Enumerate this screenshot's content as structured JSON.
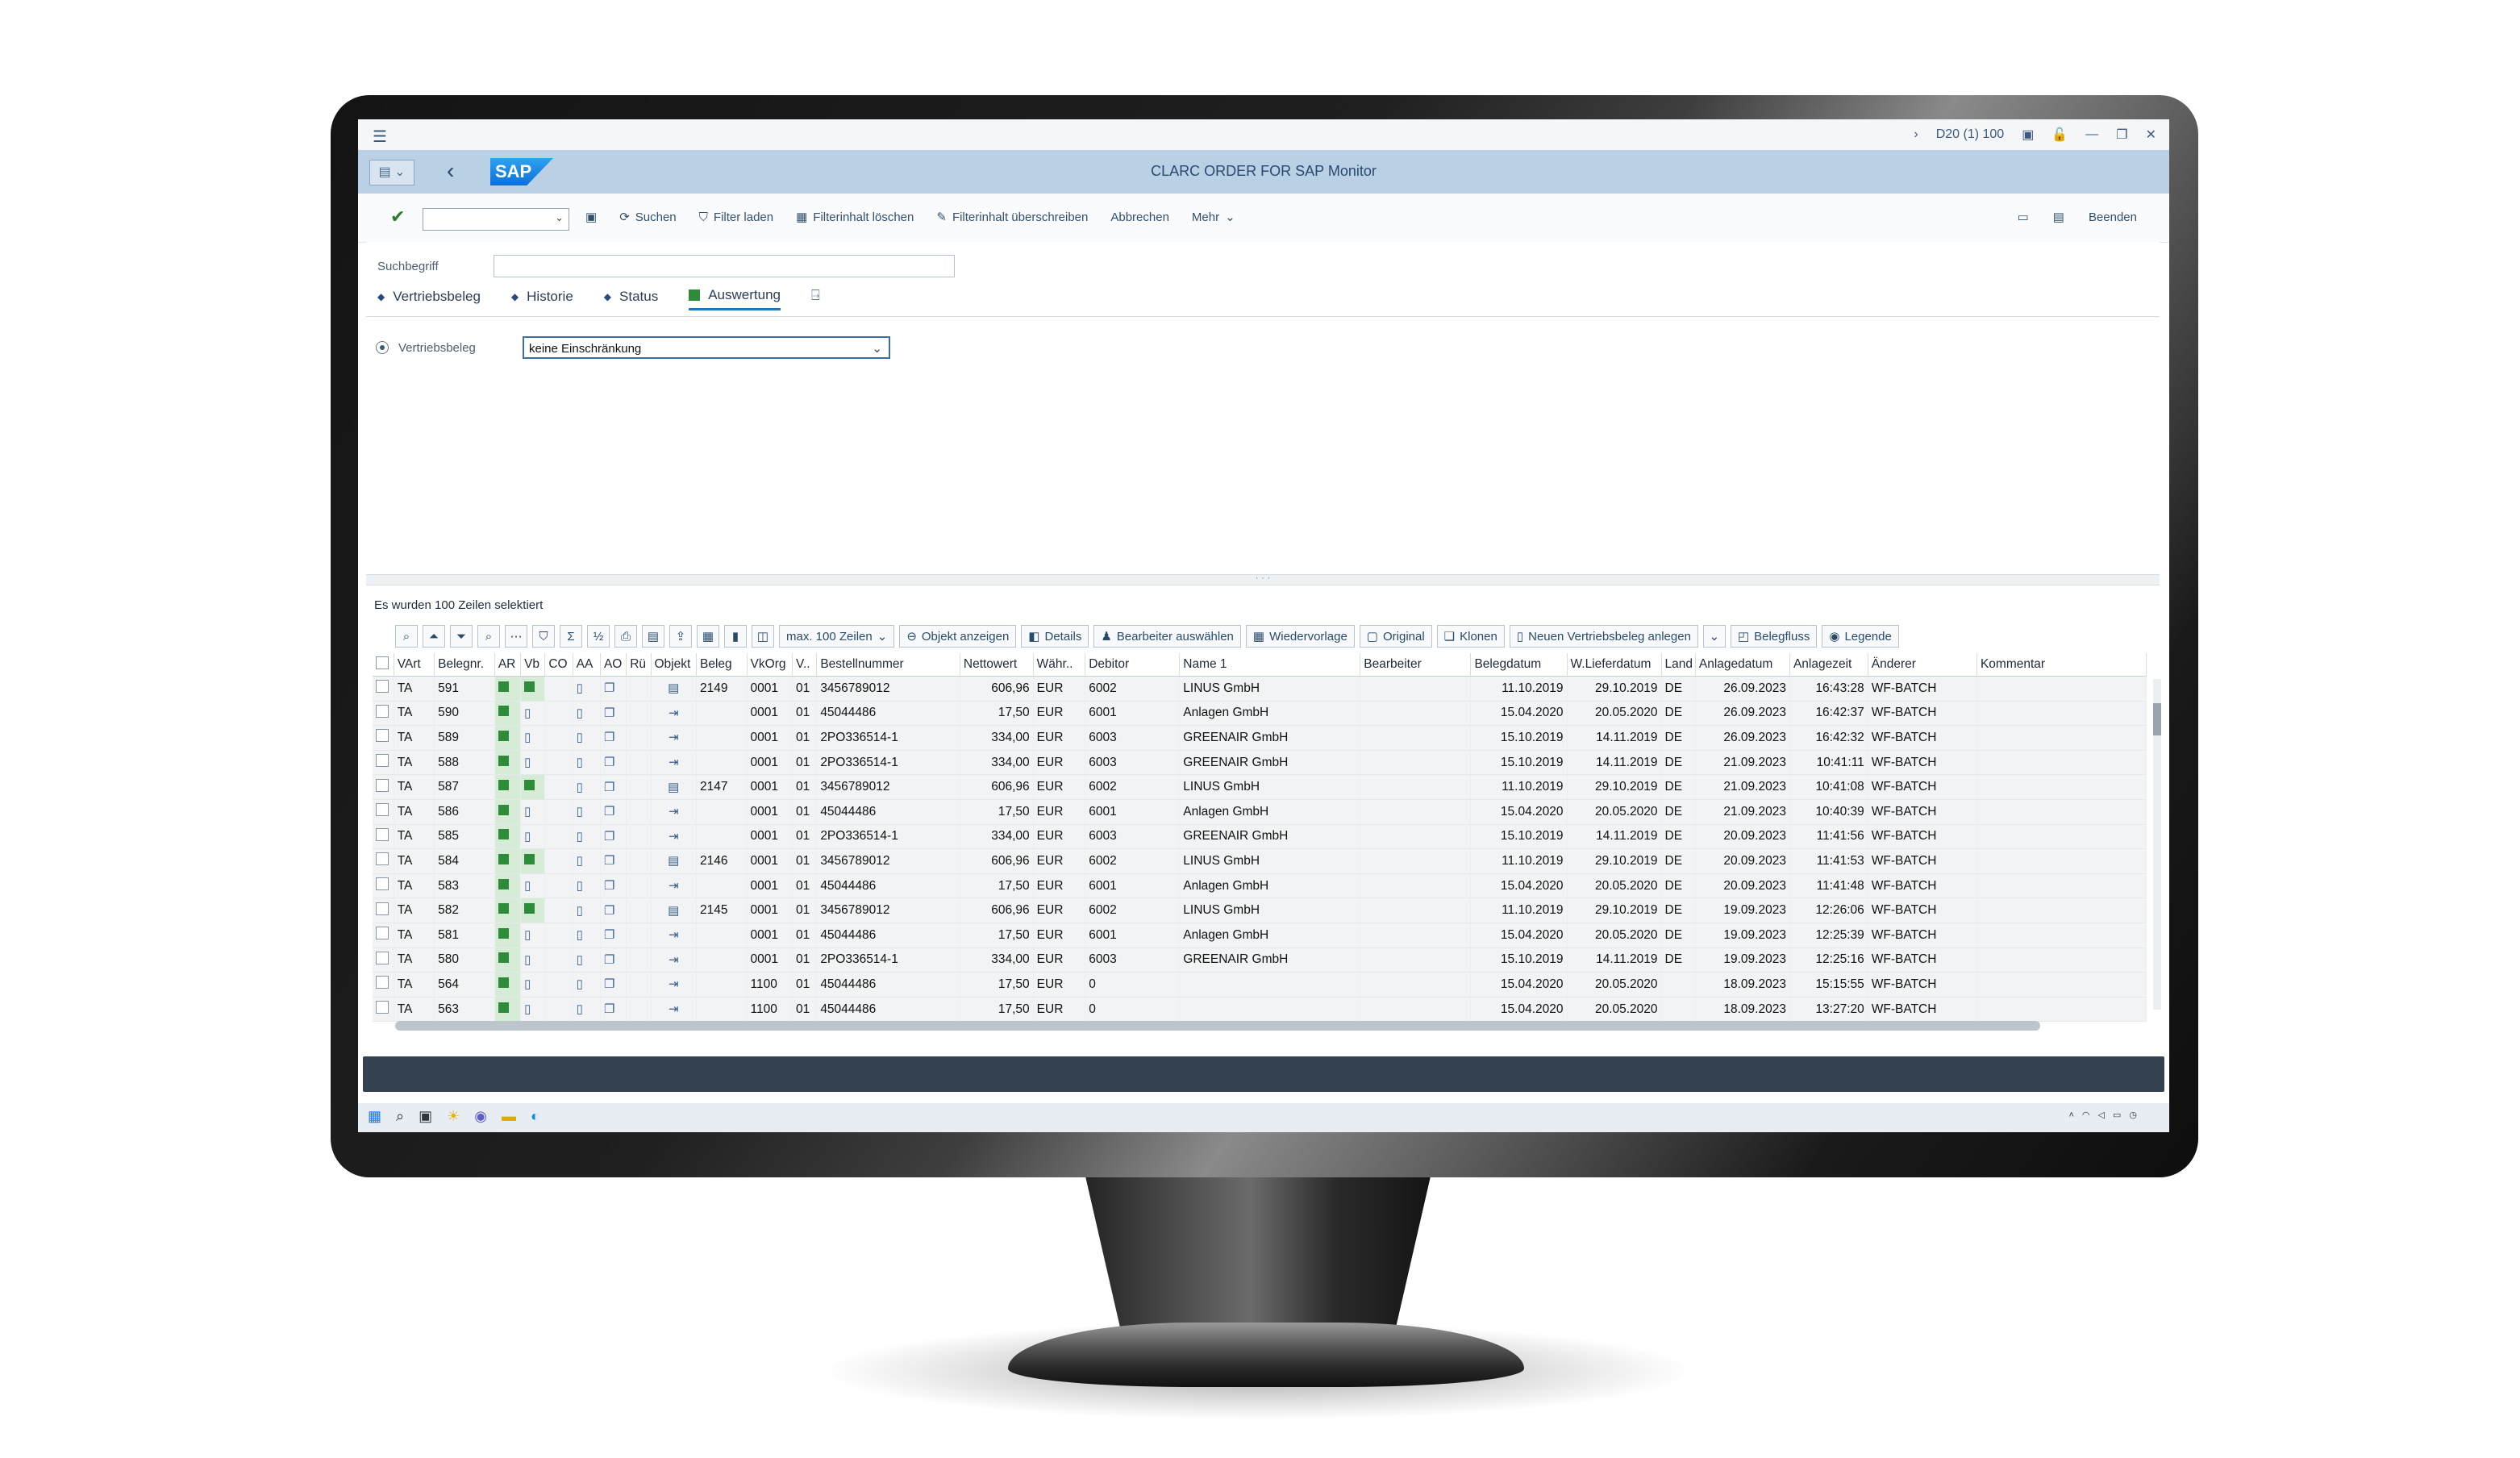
{
  "system": {
    "session": "D20 (1) 100",
    "icons": [
      "chevron-right-icon",
      "session-icon",
      "lock-icon",
      "minimize-icon",
      "maximize-icon",
      "close-icon"
    ]
  },
  "title": {
    "app": "CLARC ORDER FOR SAP Monitor",
    "logo": "SAP"
  },
  "toolbar": {
    "items": [
      "Suchen",
      "Filter laden",
      "Filterinhalt löschen",
      "Filterinhalt überschreiben",
      "Abbrechen",
      "Mehr"
    ],
    "exit": "Beenden"
  },
  "selection": {
    "search_label": "Suchbegriff",
    "search_value": "",
    "tabs": [
      "Vertriebsbeleg",
      "Historie",
      "Status",
      "Auswertung"
    ],
    "active_tab": "Auswertung",
    "field_label": "Vertriebsbeleg",
    "field_value": "keine Einschränkung"
  },
  "result": {
    "info": "Es wurden 100 Zeilen selektiert",
    "toolbar": {
      "max_rows": "max. 100 Zeilen",
      "buttons": [
        "Objekt anzeigen",
        "Details",
        "Bearbeiter auswählen",
        "Wiedervorlage",
        "Original",
        "Klonen",
        "Neuen Vertriebsbeleg anlegen",
        "Belegfluss",
        "Legende"
      ]
    },
    "columns": [
      "VArt",
      "Belegnr.",
      "AR",
      "Vb",
      "CO",
      "AA",
      "AO",
      "Rü",
      "Objekt",
      "Beleg",
      "VkOrg",
      "V..",
      "Bestellnummer",
      "Nettowert",
      "Währ..",
      "Debitor",
      "Name 1",
      "Bearbeiter",
      "Belegdatum",
      "W.Lieferdatum",
      "Land",
      "Anlagedatum",
      "Anlagezeit",
      "Änderer",
      "Kommentar"
    ],
    "rows": [
      {
        "vart": "TA",
        "belegnr": "591",
        "ar": true,
        "vb": true,
        "beleg": "2149",
        "vkorg": "0001",
        "v": "01",
        "bestell": "3456789012",
        "netto": "606,96",
        "waehr": "EUR",
        "debitor": "6002",
        "name": "LINUS GmbH",
        "belegdatum": "11.10.2019",
        "liefer": "29.10.2019",
        "land": "DE",
        "anlagedatum": "26.09.2023",
        "zeit": "16:43:28",
        "aenderer": "WF-BATCH"
      },
      {
        "vart": "TA",
        "belegnr": "590",
        "ar": true,
        "vb": false,
        "beleg": "",
        "vkorg": "0001",
        "v": "01",
        "bestell": "45044486",
        "netto": "17,50",
        "waehr": "EUR",
        "debitor": "6001",
        "name": "Anlagen GmbH",
        "belegdatum": "15.04.2020",
        "liefer": "20.05.2020",
        "land": "DE",
        "anlagedatum": "26.09.2023",
        "zeit": "16:42:37",
        "aenderer": "WF-BATCH"
      },
      {
        "vart": "TA",
        "belegnr": "589",
        "ar": true,
        "vb": false,
        "beleg": "",
        "vkorg": "0001",
        "v": "01",
        "bestell": "2PO336514-1",
        "netto": "334,00",
        "waehr": "EUR",
        "debitor": "6003",
        "name": "GREENAIR GmbH",
        "belegdatum": "15.10.2019",
        "liefer": "14.11.2019",
        "land": "DE",
        "anlagedatum": "26.09.2023",
        "zeit": "16:42:32",
        "aenderer": "WF-BATCH"
      },
      {
        "vart": "TA",
        "belegnr": "588",
        "ar": true,
        "vb": false,
        "beleg": "",
        "vkorg": "0001",
        "v": "01",
        "bestell": "2PO336514-1",
        "netto": "334,00",
        "waehr": "EUR",
        "debitor": "6003",
        "name": "GREENAIR GmbH",
        "belegdatum": "15.10.2019",
        "liefer": "14.11.2019",
        "land": "DE",
        "anlagedatum": "21.09.2023",
        "zeit": "10:41:11",
        "aenderer": "WF-BATCH"
      },
      {
        "vart": "TA",
        "belegnr": "587",
        "ar": true,
        "vb": true,
        "beleg": "2147",
        "vkorg": "0001",
        "v": "01",
        "bestell": "3456789012",
        "netto": "606,96",
        "waehr": "EUR",
        "debitor": "6002",
        "name": "LINUS GmbH",
        "belegdatum": "11.10.2019",
        "liefer": "29.10.2019",
        "land": "DE",
        "anlagedatum": "21.09.2023",
        "zeit": "10:41:08",
        "aenderer": "WF-BATCH"
      },
      {
        "vart": "TA",
        "belegnr": "586",
        "ar": true,
        "vb": false,
        "beleg": "",
        "vkorg": "0001",
        "v": "01",
        "bestell": "45044486",
        "netto": "17,50",
        "waehr": "EUR",
        "debitor": "6001",
        "name": "Anlagen GmbH",
        "belegdatum": "15.04.2020",
        "liefer": "20.05.2020",
        "land": "DE",
        "anlagedatum": "21.09.2023",
        "zeit": "10:40:39",
        "aenderer": "WF-BATCH"
      },
      {
        "vart": "TA",
        "belegnr": "585",
        "ar": true,
        "vb": false,
        "beleg": "",
        "vkorg": "0001",
        "v": "01",
        "bestell": "2PO336514-1",
        "netto": "334,00",
        "waehr": "EUR",
        "debitor": "6003",
        "name": "GREENAIR GmbH",
        "belegdatum": "15.10.2019",
        "liefer": "14.11.2019",
        "land": "DE",
        "anlagedatum": "20.09.2023",
        "zeit": "11:41:56",
        "aenderer": "WF-BATCH"
      },
      {
        "vart": "TA",
        "belegnr": "584",
        "ar": true,
        "vb": true,
        "beleg": "2146",
        "vkorg": "0001",
        "v": "01",
        "bestell": "3456789012",
        "netto": "606,96",
        "waehr": "EUR",
        "debitor": "6002",
        "name": "LINUS GmbH",
        "belegdatum": "11.10.2019",
        "liefer": "29.10.2019",
        "land": "DE",
        "anlagedatum": "20.09.2023",
        "zeit": "11:41:53",
        "aenderer": "WF-BATCH"
      },
      {
        "vart": "TA",
        "belegnr": "583",
        "ar": true,
        "vb": false,
        "beleg": "",
        "vkorg": "0001",
        "v": "01",
        "bestell": "45044486",
        "netto": "17,50",
        "waehr": "EUR",
        "debitor": "6001",
        "name": "Anlagen GmbH",
        "belegdatum": "15.04.2020",
        "liefer": "20.05.2020",
        "land": "DE",
        "anlagedatum": "20.09.2023",
        "zeit": "11:41:48",
        "aenderer": "WF-BATCH"
      },
      {
        "vart": "TA",
        "belegnr": "582",
        "ar": true,
        "vb": true,
        "beleg": "2145",
        "vkorg": "0001",
        "v": "01",
        "bestell": "3456789012",
        "netto": "606,96",
        "waehr": "EUR",
        "debitor": "6002",
        "name": "LINUS GmbH",
        "belegdatum": "11.10.2019",
        "liefer": "29.10.2019",
        "land": "DE",
        "anlagedatum": "19.09.2023",
        "zeit": "12:26:06",
        "aenderer": "WF-BATCH"
      },
      {
        "vart": "TA",
        "belegnr": "581",
        "ar": true,
        "vb": false,
        "beleg": "",
        "vkorg": "0001",
        "v": "01",
        "bestell": "45044486",
        "netto": "17,50",
        "waehr": "EUR",
        "debitor": "6001",
        "name": "Anlagen GmbH",
        "belegdatum": "15.04.2020",
        "liefer": "20.05.2020",
        "land": "DE",
        "anlagedatum": "19.09.2023",
        "zeit": "12:25:39",
        "aenderer": "WF-BATCH"
      },
      {
        "vart": "TA",
        "belegnr": "580",
        "ar": true,
        "vb": false,
        "beleg": "",
        "vkorg": "0001",
        "v": "01",
        "bestell": "2PO336514-1",
        "netto": "334,00",
        "waehr": "EUR",
        "debitor": "6003",
        "name": "GREENAIR GmbH",
        "belegdatum": "15.10.2019",
        "liefer": "14.11.2019",
        "land": "DE",
        "anlagedatum": "19.09.2023",
        "zeit": "12:25:16",
        "aenderer": "WF-BATCH"
      },
      {
        "vart": "TA",
        "belegnr": "564",
        "ar": true,
        "vb": false,
        "beleg": "",
        "vkorg": "1100",
        "v": "01",
        "bestell": "45044486",
        "netto": "17,50",
        "waehr": "EUR",
        "debitor": "0",
        "name": "",
        "belegdatum": "15.04.2020",
        "liefer": "20.05.2020",
        "land": "",
        "anlagedatum": "18.09.2023",
        "zeit": "15:15:55",
        "aenderer": "WF-BATCH"
      },
      {
        "vart": "TA",
        "belegnr": "563",
        "ar": true,
        "vb": false,
        "beleg": "",
        "vkorg": "1100",
        "v": "01",
        "bestell": "45044486",
        "netto": "17,50",
        "waehr": "EUR",
        "debitor": "0",
        "name": "",
        "belegdatum": "15.04.2020",
        "liefer": "20.05.2020",
        "land": "",
        "anlagedatum": "18.09.2023",
        "zeit": "13:27:20",
        "aenderer": "WF-BATCH"
      }
    ]
  },
  "colors": {
    "title_bar": "#b9d0e5",
    "status_green": "#2e8b3a",
    "footer_bar": "#334150"
  }
}
